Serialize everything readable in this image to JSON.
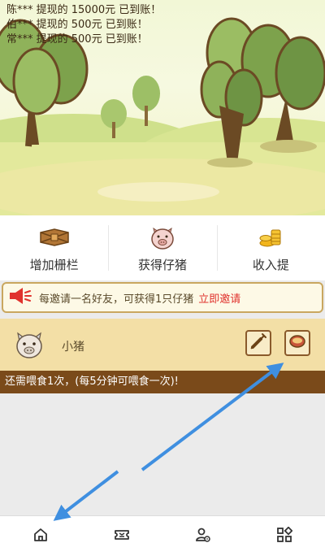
{
  "ticker": [
    "陈*** 提现的 15000元 已到账！",
    "伯*** 提现的 500元 已到账！",
    "常*** 提现的 500元 已到账！"
  ],
  "menu": {
    "fence_label": "增加栅栏",
    "piglet_label": "获得仔猪",
    "income_label": "收入提"
  },
  "invite": {
    "text": "每邀请一名好友，可获得1只仔猪",
    "link": "立即邀请"
  },
  "pig": {
    "name": "小猪",
    "status": "还需喂食1次，(每5分钟可喂食一次)!"
  },
  "icons": {
    "speaker": "speaker-icon",
    "syringe": "syringe-icon",
    "food_bowl": "food-bowl-icon",
    "home": "home-icon",
    "ticket": "ticket-icon",
    "user_settings": "user-settings-icon",
    "grid": "grid-icon"
  },
  "colors": {
    "accent_red": "#e0322d",
    "status_bar": "#7a4a1a",
    "card_bg": "#f3dfa6",
    "annotation_arrow": "#3f8fe0"
  }
}
